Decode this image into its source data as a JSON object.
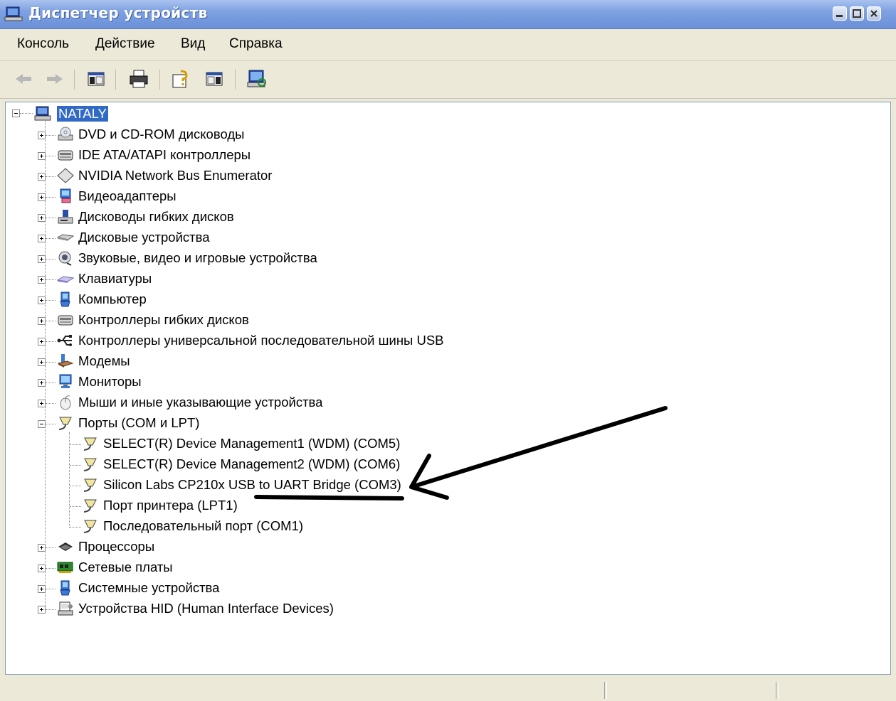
{
  "window": {
    "title": "Диспетчер устройств"
  },
  "menu": [
    "Консоль",
    "Действие",
    "Вид",
    "Справка"
  ],
  "toolbar": {
    "buttons": [
      "back-arrow-icon",
      "forward-arrow-icon",
      "console-tree-icon",
      "print-icon",
      "help-icon",
      "view-icon",
      "scan-hardware-icon"
    ]
  },
  "tree": {
    "root": "NATALY",
    "categories": [
      {
        "label": "DVD и CD-ROM дисководы",
        "icon": "cdrom-icon"
      },
      {
        "label": "IDE ATA/ATAPI контроллеры",
        "icon": "ide-controller-icon"
      },
      {
        "label": "NVIDIA Network Bus Enumerator",
        "icon": "diamond-device-icon"
      },
      {
        "label": "Видеоадаптеры",
        "icon": "video-adapter-icon"
      },
      {
        "label": "Дисководы гибких дисков",
        "icon": "floppy-drive-icon"
      },
      {
        "label": "Дисковые устройства",
        "icon": "disk-drive-icon"
      },
      {
        "label": "Звуковые, видео и игровые устройства",
        "icon": "sound-icon"
      },
      {
        "label": "Клавиатуры",
        "icon": "keyboard-icon"
      },
      {
        "label": "Компьютер",
        "icon": "computer-icon"
      },
      {
        "label": "Контроллеры гибких дисков",
        "icon": "floppy-controller-icon"
      },
      {
        "label": "Контроллеры универсальной последовательной шины USB",
        "icon": "usb-icon"
      },
      {
        "label": "Модемы",
        "icon": "modem-icon"
      },
      {
        "label": "Мониторы",
        "icon": "monitor-icon"
      },
      {
        "label": "Мыши и иные указывающие устройства",
        "icon": "mouse-icon"
      }
    ],
    "ports": {
      "label": "Порты (COM и LPT)",
      "children": [
        "SELECT(R) Device Management1 (WDM) (COM5)",
        "SELECT(R) Device Management2 (WDM) (COM6)",
        "Silicon Labs CP210x USB to UART Bridge (COM3)",
        "Порт принтера (LPT1)",
        "Последовательный порт (COM1)"
      ]
    },
    "after": [
      {
        "label": "Процессоры",
        "icon": "processor-icon"
      },
      {
        "label": "Сетевые платы",
        "icon": "network-card-icon"
      },
      {
        "label": "Системные устройства",
        "icon": "system-devices-icon"
      },
      {
        "label": "Устройства HID (Human Interface Devices)",
        "icon": "hid-icon"
      }
    ]
  },
  "colors": {
    "titlebar": "#7ea1e0",
    "selection": "#316ac5",
    "annotation": "#000000"
  }
}
